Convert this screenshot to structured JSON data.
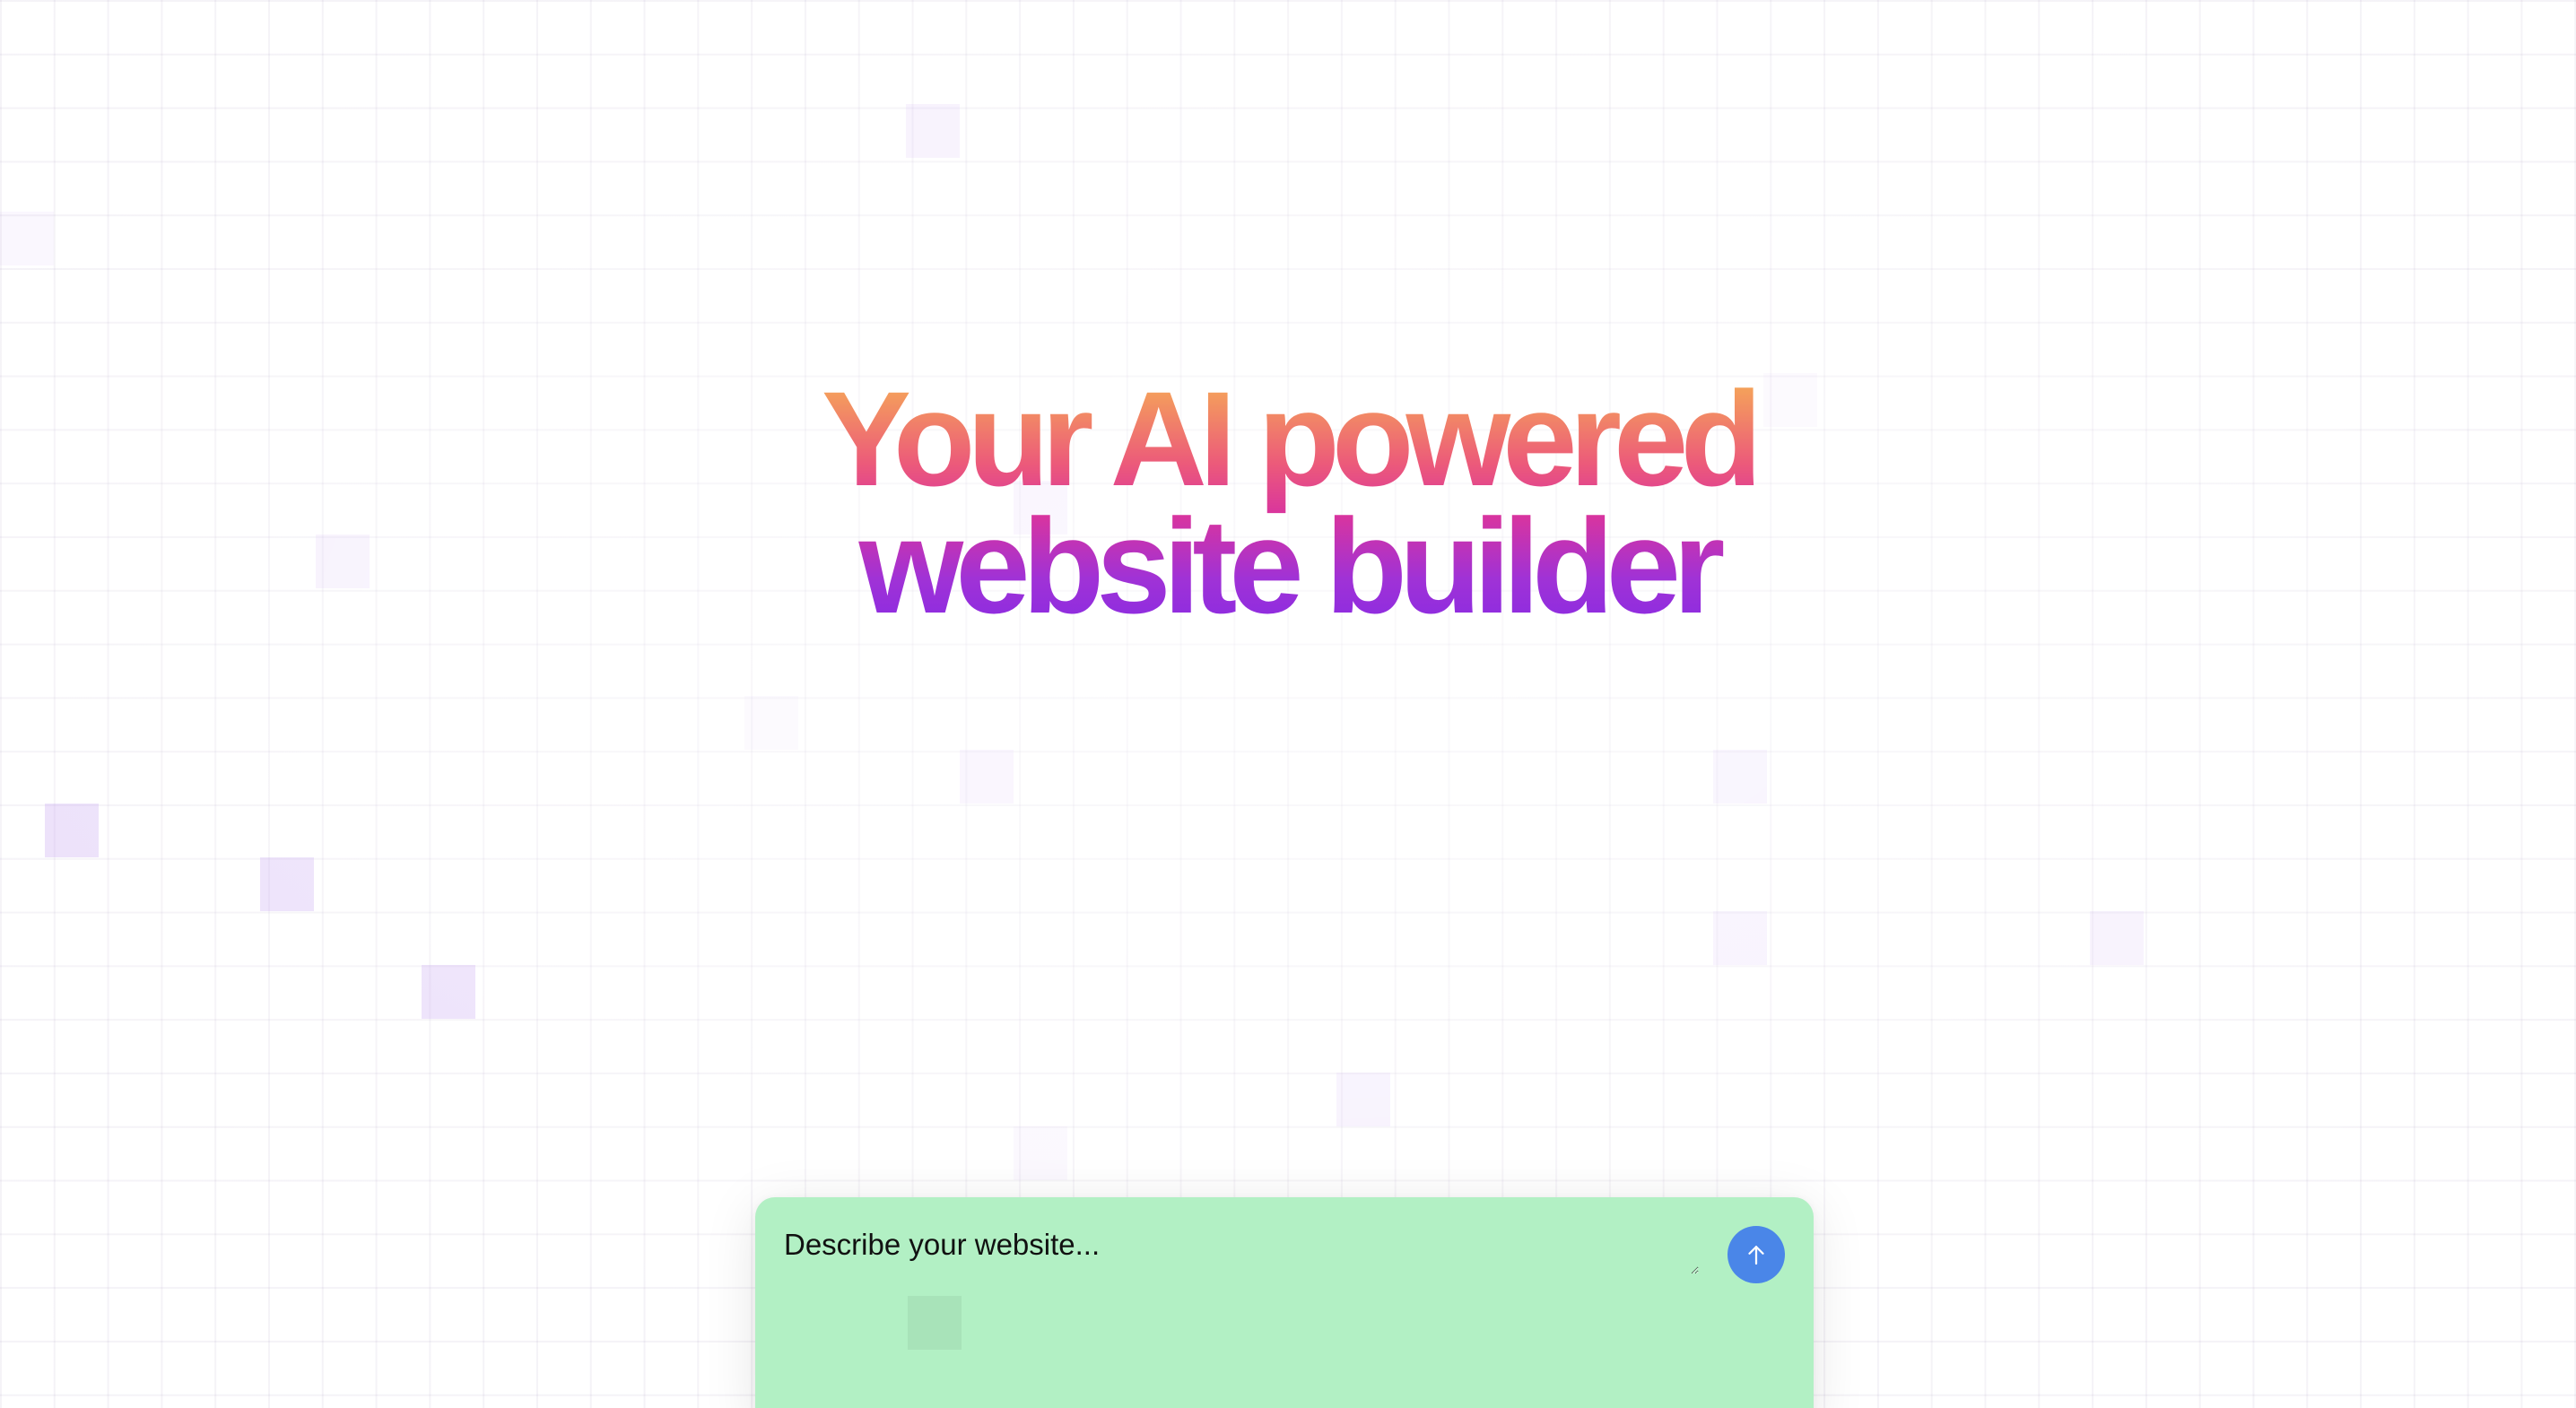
{
  "hero": {
    "line1": "Your AI powered",
    "line2": "website builder"
  },
  "prompt": {
    "placeholder": "Describe your website...",
    "value": "",
    "submit_icon": "arrow-up-icon"
  },
  "colors": {
    "page_background": "#ffffff",
    "grid_line": "#ece6f3",
    "highlight_cell": "#e2d2fb",
    "gradient_top": "#f6ad55",
    "gradient_mid": "#d9349e",
    "gradient_bottom": "#8a2be2",
    "prompt_background": "#b2f0c4",
    "send_button": "#4a86e8"
  }
}
